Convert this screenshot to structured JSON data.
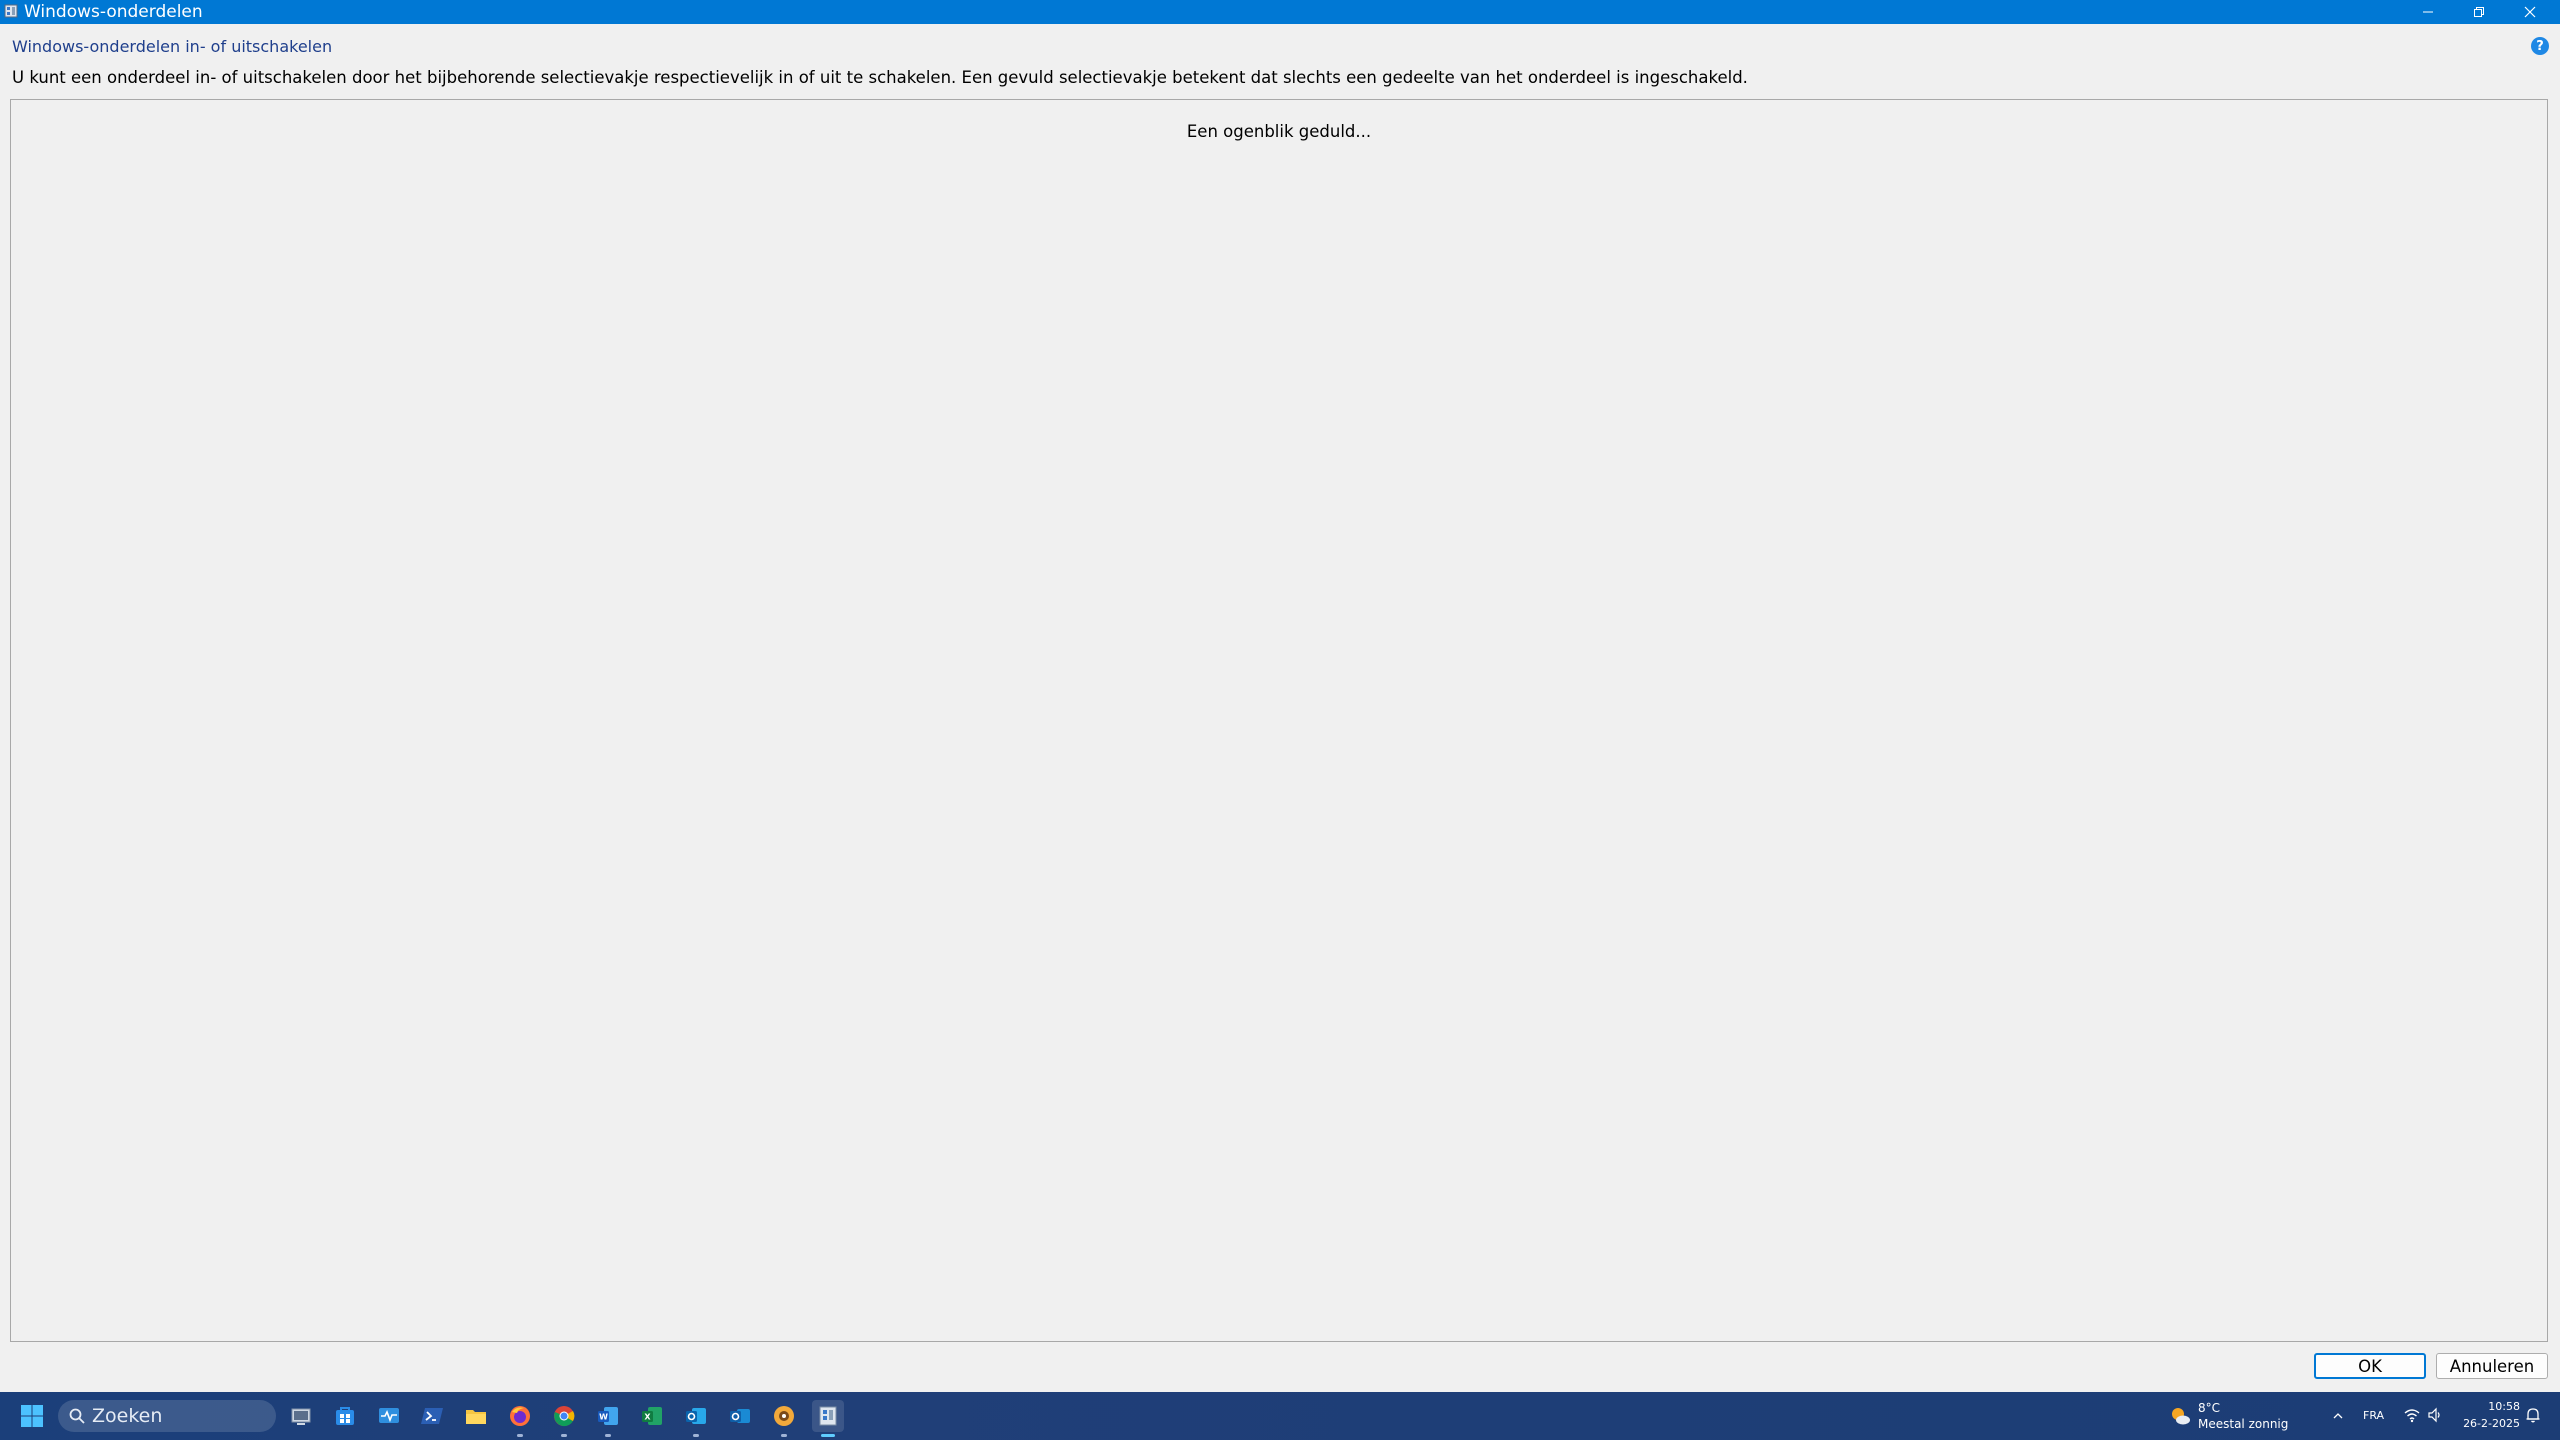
{
  "window": {
    "title": "Windows-onderdelen"
  },
  "header": {
    "link_text": "Windows-onderdelen in- of uitschakelen",
    "help_icon_glyph": "?",
    "description": "U kunt een onderdeel in- of uitschakelen door het bijbehorende selectievakje respectievelijk in of uit te schakelen. Een gevuld selectievakje betekent dat slechts een gedeelte van het onderdeel is ingeschakeld."
  },
  "panel": {
    "status_text": "Een ogenblik geduld..."
  },
  "buttons": {
    "ok_label": "OK",
    "cancel_label": "Annuleren"
  },
  "taskbar": {
    "search_placeholder": "Zoeken",
    "weather_temp": "8°C",
    "weather_desc": "Meestal zonnig",
    "language": "FRA",
    "time": "10:58",
    "date": "26-2-2025",
    "apps": [
      "file-manager-icon",
      "store-icon",
      "monitor-app-icon",
      "powershell-icon",
      "file-explorer-icon",
      "firefox-icon",
      "chrome-icon",
      "word-icon",
      "excel-icon",
      "outlook-classic-icon",
      "outlook-new-icon",
      "app-icon",
      "windows-features-icon"
    ]
  },
  "colors": {
    "titlebar": "#0078d4",
    "accent": "#0078d4",
    "taskbar": "#1e3e77"
  }
}
